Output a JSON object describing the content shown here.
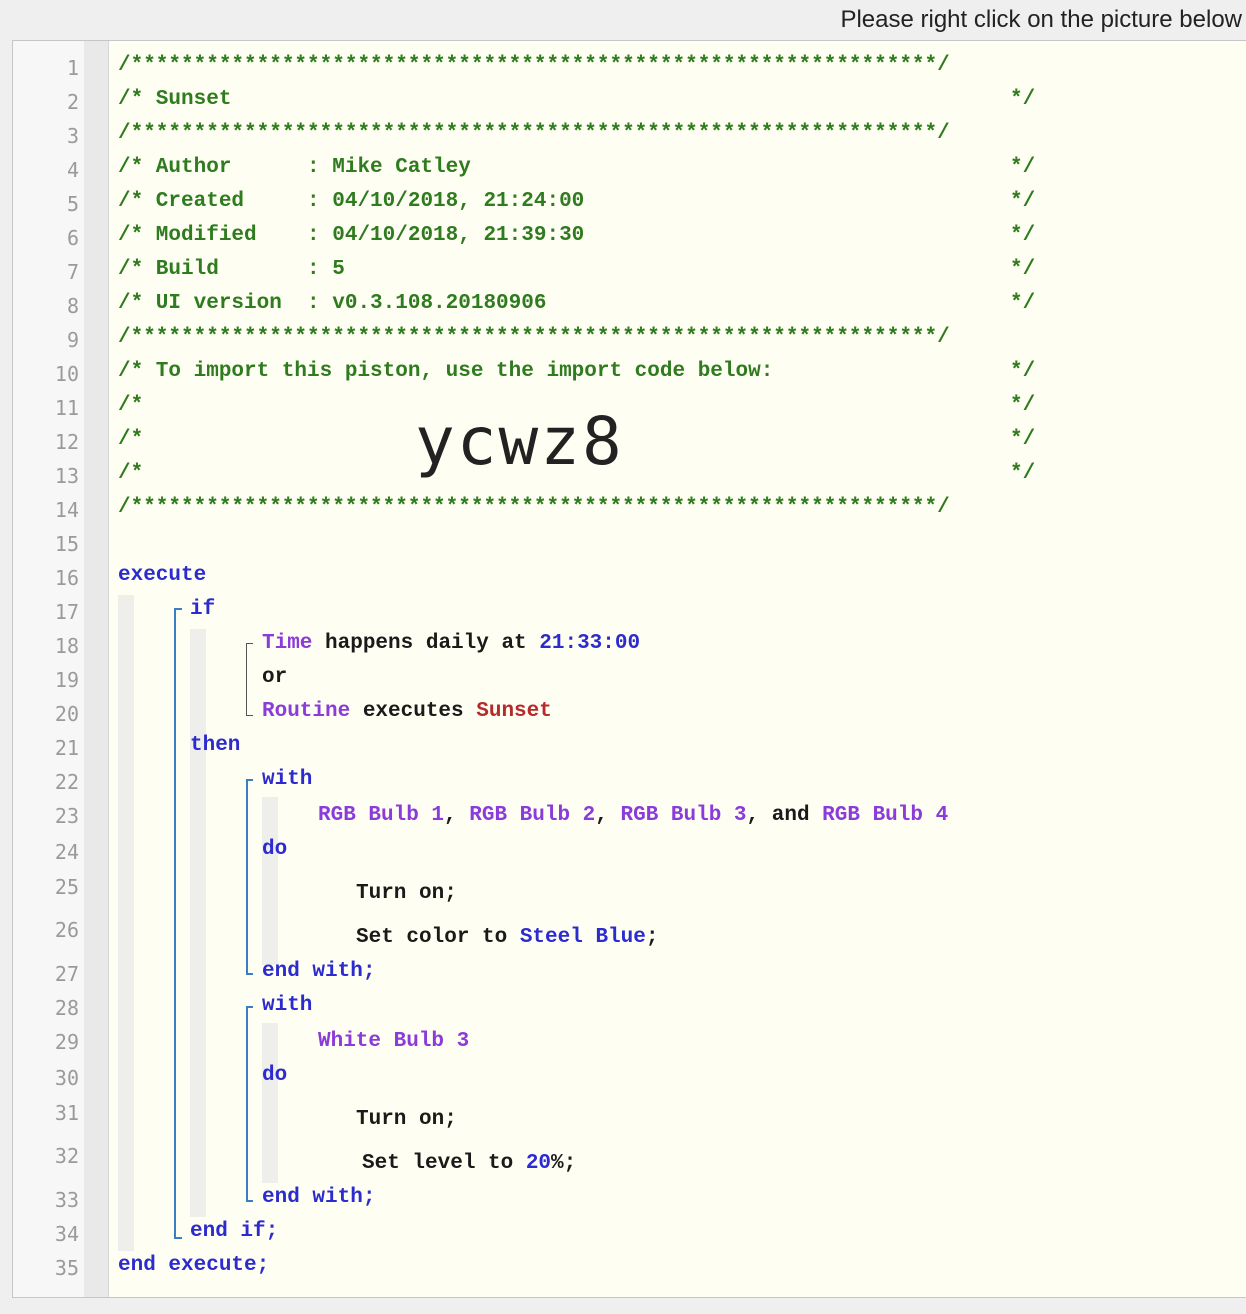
{
  "hint": "Please right click on the picture below",
  "line_numbers": [
    "1",
    "2",
    "3",
    "4",
    "5",
    "6",
    "7",
    "8",
    "9",
    "10",
    "11",
    "12",
    "13",
    "14",
    "15",
    "16",
    "17",
    "18",
    "19",
    "20",
    "21",
    "22",
    "23",
    "24",
    "25",
    "26",
    "27",
    "28",
    "29",
    "30",
    "31",
    "32",
    "33",
    "34",
    "35"
  ],
  "header": {
    "stars": "/****************************************************************/",
    "title_open": "/* Sunset",
    "close": "*/",
    "author": "/* Author      : Mike Catley",
    "created": "/* Created     : 04/10/2018, 21:24:00",
    "modified": "/* Modified    : 04/10/2018, 21:39:30",
    "build": "/* Build       : 5",
    "ui_version": "/* UI version  : v0.3.108.20180906",
    "import_text": "/* To import this piston, use the import code below:",
    "comment_open": "/*",
    "import_code": "ycwz8"
  },
  "code": {
    "execute": "execute",
    "if": "if",
    "time": "Time",
    "happens": " happens daily at ",
    "time_value": "21:33:00",
    "or": "or",
    "routine": "Routine",
    "executes": " executes ",
    "routine_name": "Sunset",
    "then": "then",
    "with": "with",
    "do": "do",
    "rgb1": "RGB Bulb 1",
    "rgb2": "RGB Bulb 2",
    "rgb3": "RGB Bulb 3",
    "rgb4": "RGB Bulb 4",
    "comma": ", ",
    "and": ", and ",
    "turn_on": "Turn on;",
    "set_color": "Set color to ",
    "color_value": "Steel Blue",
    "semicolon": ";",
    "end_with": "end with;",
    "white3": "White Bulb 3",
    "set_level": "Set level to ",
    "level_value": "20",
    "percent": "%;",
    "end_if": "end if;",
    "end_execute": "end execute;"
  }
}
